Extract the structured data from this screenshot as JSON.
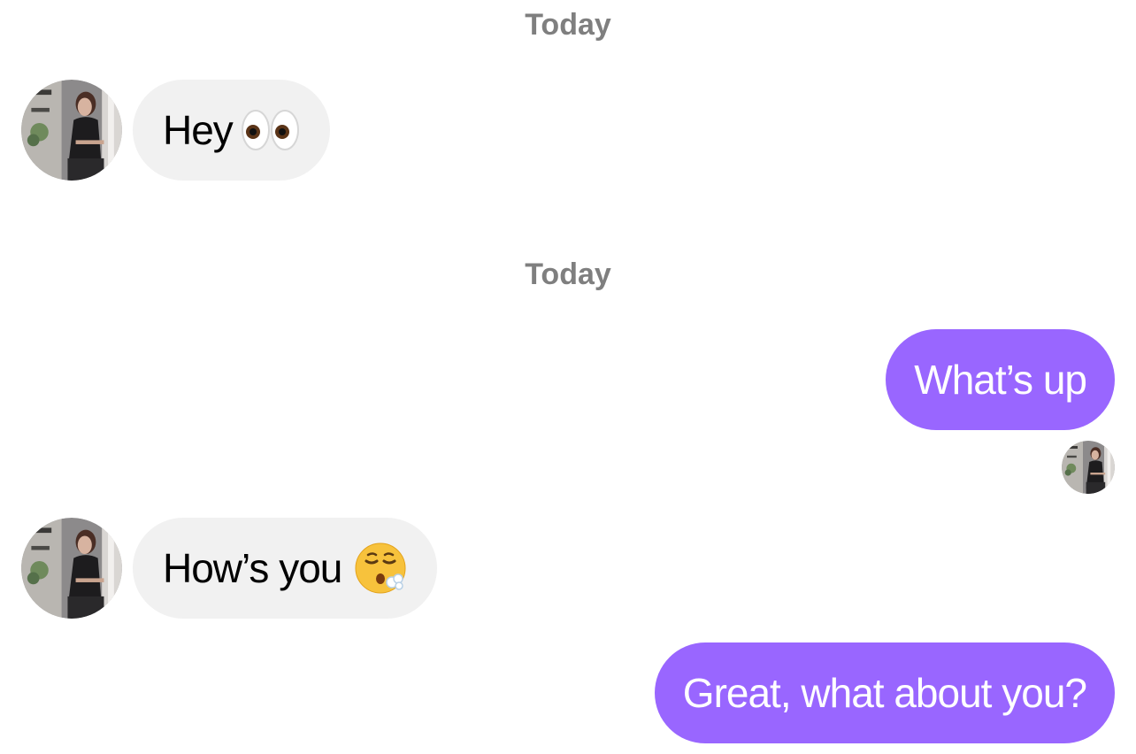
{
  "chat": {
    "separators": [
      "Today",
      "Today"
    ],
    "messages": [
      {
        "direction": "incoming",
        "text": "Hey",
        "emoji": "eyes-emoji"
      },
      {
        "direction": "outgoing",
        "text": "What’s up"
      },
      {
        "direction": "incoming",
        "text": "How’s you",
        "emoji": "exhaling-face-emoji"
      },
      {
        "direction": "outgoing",
        "text": "Great, what about you?"
      }
    ]
  },
  "colors": {
    "outgoing_bubble": "#9966ff",
    "incoming_bubble": "#f1f1f1",
    "separator_text": "#7f7f7f"
  },
  "icons": {
    "avatar": "contact-avatar-photo"
  }
}
